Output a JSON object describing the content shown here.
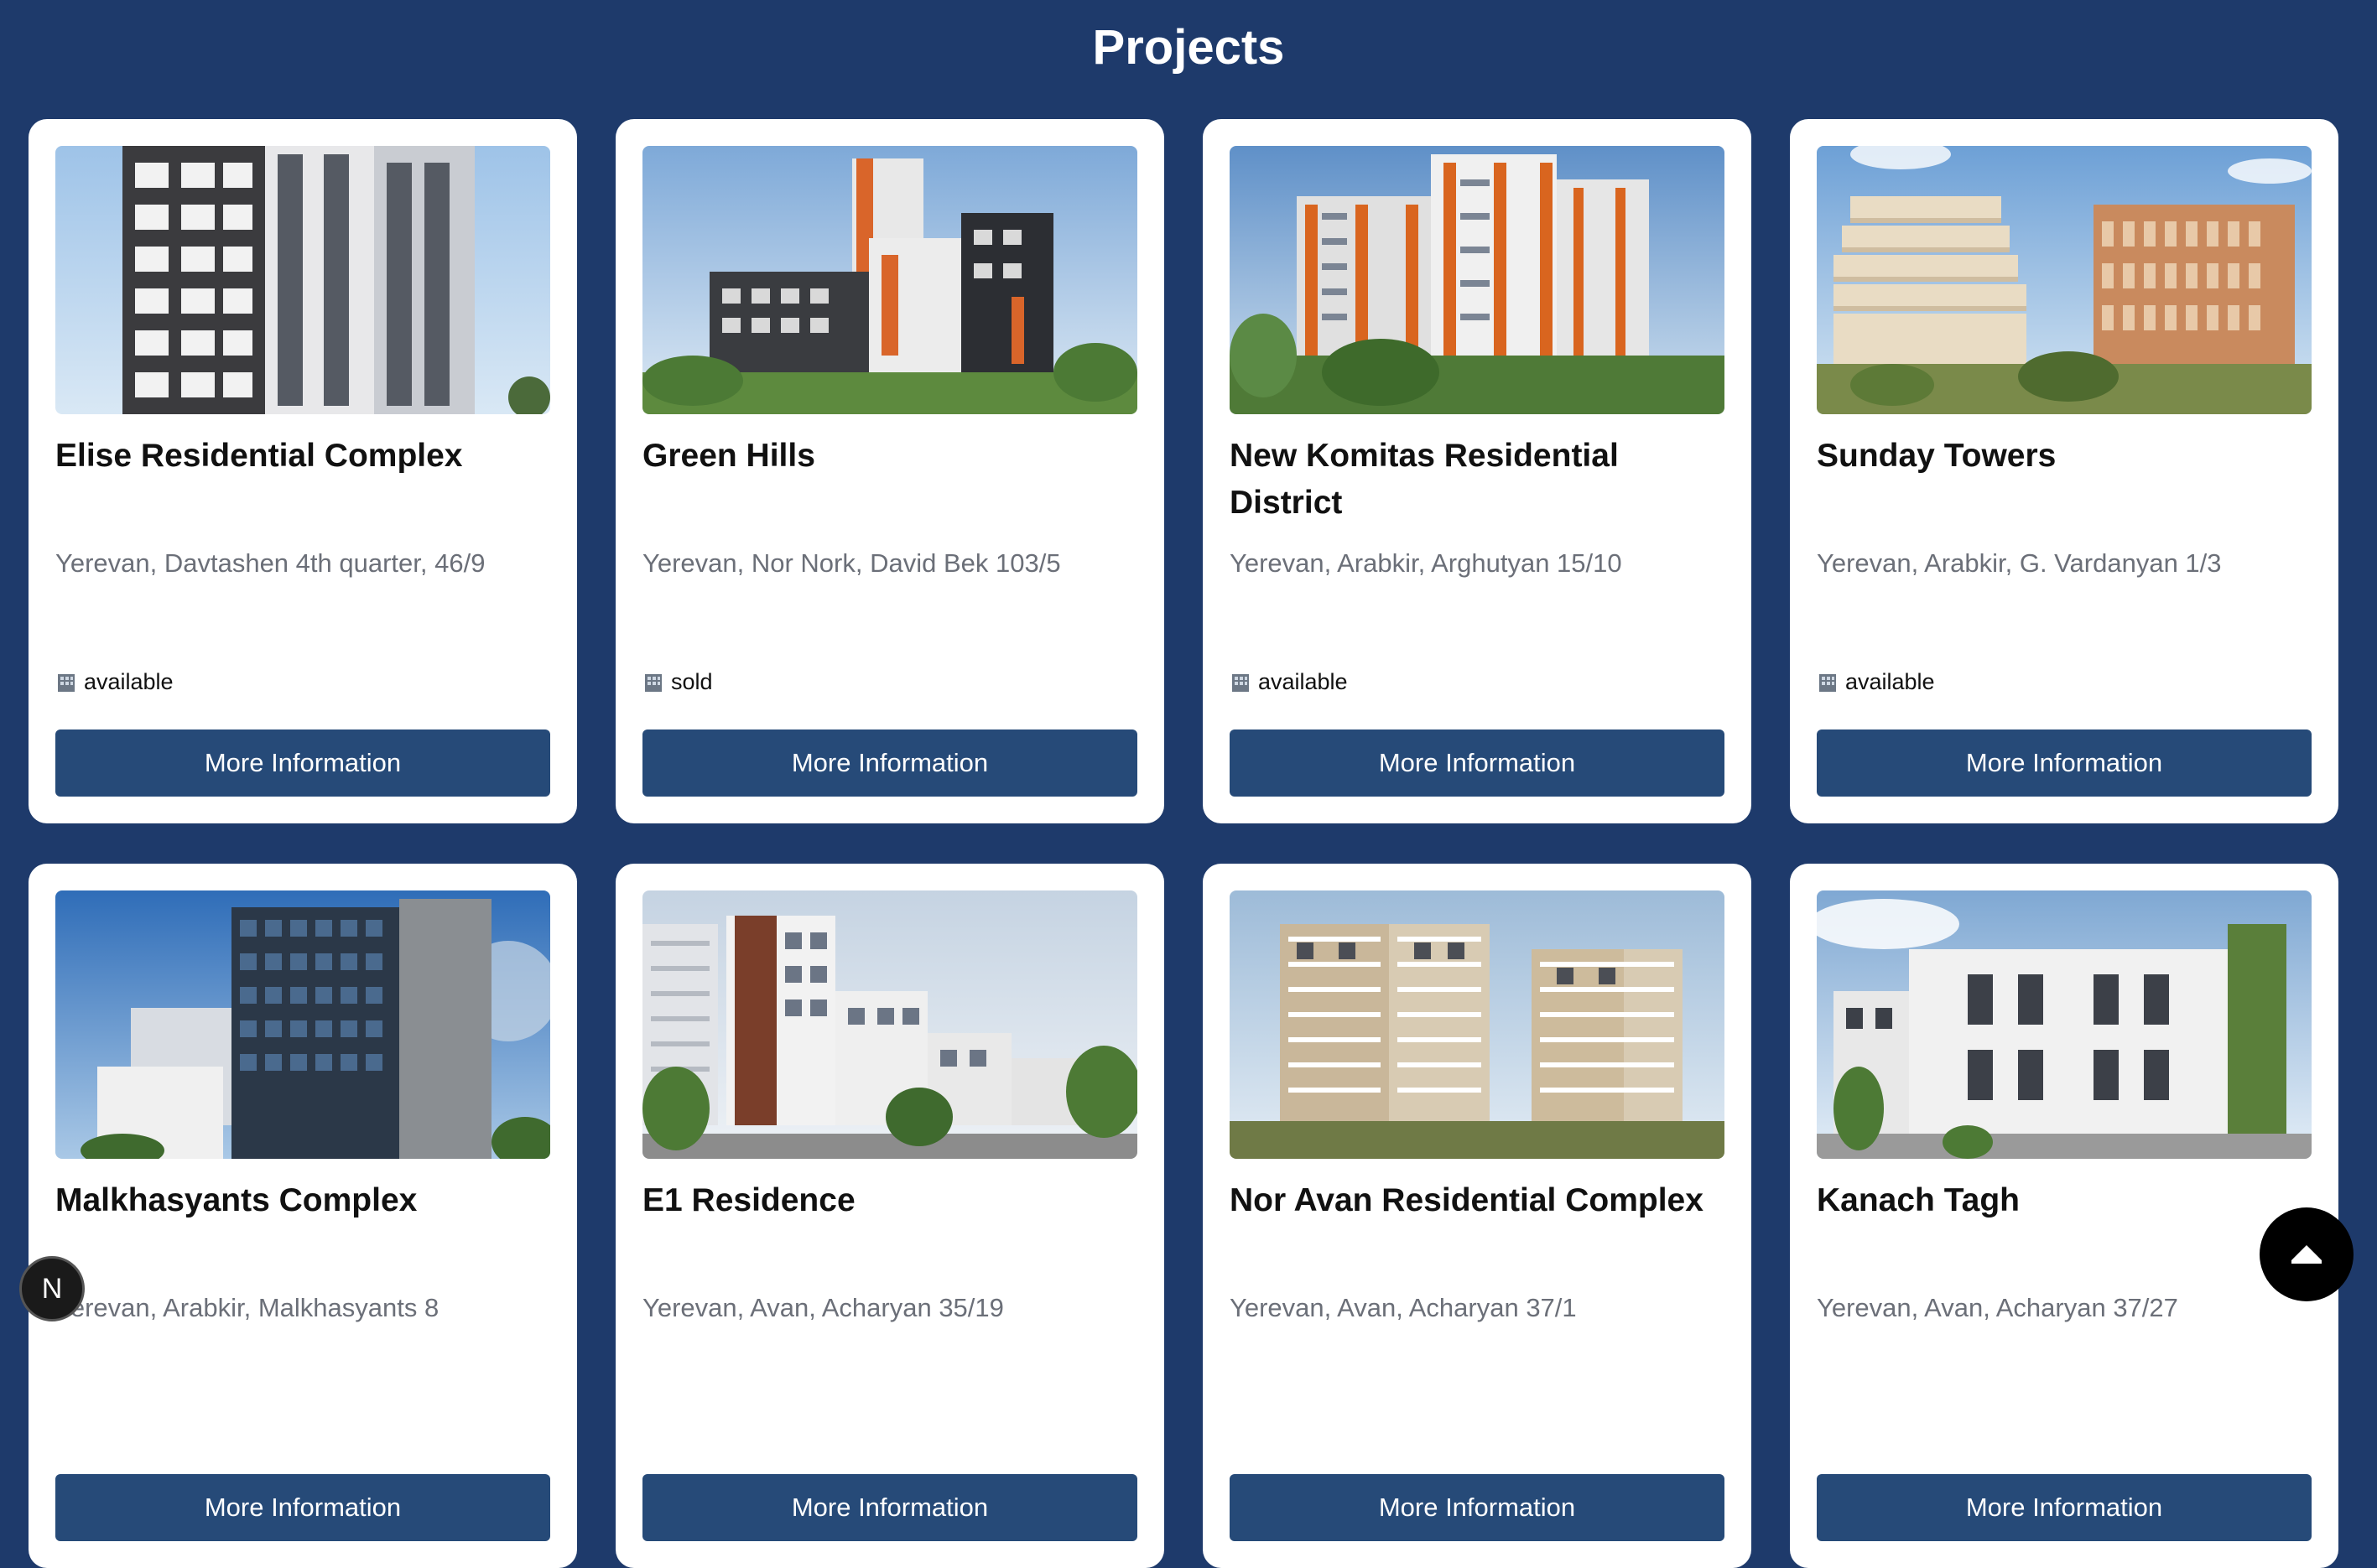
{
  "header": {
    "title": "Projects"
  },
  "projects": [
    {
      "title": "Elise Residential Complex",
      "address": "Yerevan, Davtashen 4th quarter, 46/9",
      "status": "available",
      "button_label": "More Information",
      "image": "building-photo"
    },
    {
      "title": "Green Hills",
      "address": "Yerevan, Nor Nork, David Bek 103/5",
      "status": "sold",
      "button_label": "More Information",
      "image": "building-photo"
    },
    {
      "title": "New Komitas Residential District",
      "address": "Yerevan, Arabkir, Arghutyan 15/10",
      "status": "available",
      "button_label": "More Information",
      "image": "building-photo"
    },
    {
      "title": "Sunday Towers",
      "address": "Yerevan, Arabkir, G. Vardanyan 1/3",
      "status": "available",
      "button_label": "More Information",
      "image": "building-photo"
    },
    {
      "title": "Malkhasyants Complex",
      "address": "Yerevan, Arabkir, Malkhasyants 8",
      "status": "",
      "button_label": "More Information",
      "image": "building-photo"
    },
    {
      "title": "E1 Residence",
      "address": "Yerevan, Avan, Acharyan 35/19",
      "status": "",
      "button_label": "More Information",
      "image": "building-photo"
    },
    {
      "title": "Nor Avan Residential Complex",
      "address": "Yerevan, Avan, Acharyan 37/1",
      "status": "",
      "button_label": "More Information",
      "image": "building-photo"
    },
    {
      "title": "Kanach Tagh",
      "address": "Yerevan, Avan, Acharyan 37/27",
      "status": "",
      "button_label": "More Information",
      "image": "building-photo"
    }
  ],
  "dev_badge": {
    "label": "N"
  },
  "icons": {
    "status": "building-icon",
    "scroll_top": "caret-up-icon"
  },
  "colors": {
    "background": "#1e3a6b",
    "button": "#264a78",
    "card": "#ffffff"
  }
}
